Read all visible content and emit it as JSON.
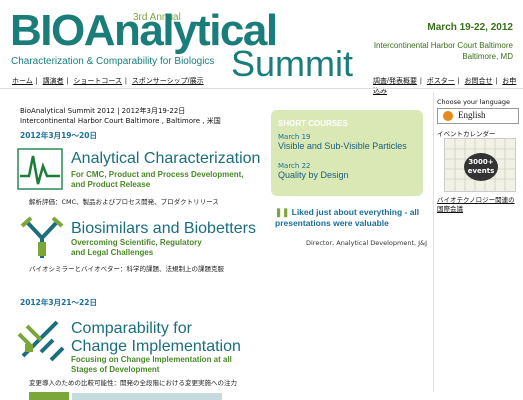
{
  "header": {
    "annual": "3rd Annual",
    "logo_main": "BIOAnalytical",
    "logo_tagline": "Characterization & Comparability for Biologics",
    "logo_summit": "Summit",
    "date": "March 19-22, 2012",
    "venue_line1": "Intercontinental Harbor Court Baltimore",
    "venue_line2": "Baltimore, MD"
  },
  "nav_left": [
    "ホーム",
    "講演者",
    "ショートコース",
    "スポンサーシップ/展示"
  ],
  "nav_right": [
    "調査/発表概要",
    "ポスター",
    "お問合せ",
    "お申込み"
  ],
  "intro": {
    "line1": "BioAnalytical Summit 2012 | 2012年3月19-22日",
    "line2": "Intercontinental Harbor Court Baltimore , Baltimore , 米国"
  },
  "sections": [
    {
      "date_header": "2012年3月19～20日",
      "title": "Analytical Characterization",
      "subtitle_1": "For CMC, Product and Process Development,",
      "subtitle_2": "and Product Release",
      "jp": "解析評価：CMC、製品およびプロセス開発、プロダクトリリース"
    },
    {
      "title": "Biosimilars and Biobetters",
      "subtitle_1": "Overcoming Scientific, Regulatory",
      "subtitle_2": "and Legal Challenges",
      "jp": "バイオシミラーとバイオベター：科学的課題、法規制上の課題克服"
    },
    {
      "date_header": "2012年3月21～22日",
      "title_1": "Comparability for",
      "title_2": "Change Implementation",
      "subtitle_1": "Focusing on Change Implementation at all",
      "subtitle_2": "Stages of Development",
      "jp": "変更導入のための比較可能性：開発の全段階における変更実施への注力"
    }
  ],
  "short_courses": {
    "heading": "SHORT COURSES",
    "items": [
      {
        "date": "March 19",
        "title": "Visible and Sub-Visible Particles"
      },
      {
        "date": "March 22",
        "title": "Quality by Design"
      }
    ]
  },
  "testimonial": {
    "quote": "Liked just about everything - all presentations were valuable",
    "author": "Director, Analytical Development, J&J"
  },
  "sidebar": {
    "lang_label": "Choose your language",
    "lang_value": "English",
    "calendar_label": "イベントカレンダー",
    "badge_1": "3000+",
    "badge_2": "events",
    "link": "バイオテクノロジー関連の国際会議"
  },
  "colors": {
    "brand": "#1a7d7a",
    "accent": "#7aa63a",
    "link": "#1a6e9a",
    "panel": "#d9e8b5"
  }
}
